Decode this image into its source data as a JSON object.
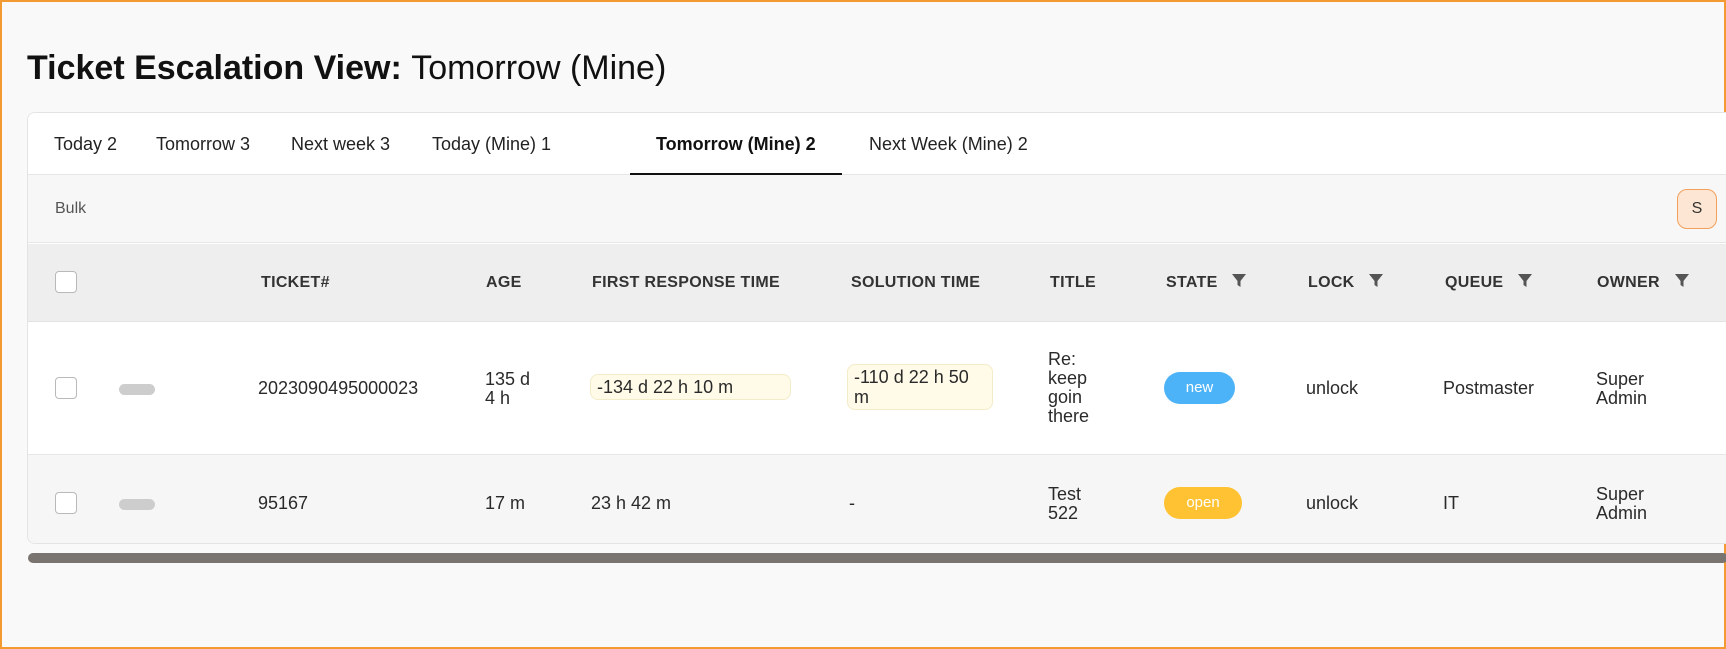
{
  "page": {
    "title_bold": "Ticket Escalation View:",
    "title_sub": "Tomorrow (Mine)"
  },
  "tabs": [
    {
      "label": "Today 2"
    },
    {
      "label": "Tomorrow 3"
    },
    {
      "label": "Next week 3"
    },
    {
      "label": "Today (Mine) 1"
    },
    {
      "label": "Tomorrow (Mine) 2"
    },
    {
      "label": "Next Week (Mine) 2"
    }
  ],
  "toolbar": {
    "bulk_label": "Bulk",
    "settings_label": "S"
  },
  "table": {
    "headers": {
      "ticket": "TICKET#",
      "age": "AGE",
      "first_response": "FIRST RESPONSE TIME",
      "solution": "SOLUTION TIME",
      "title": "TITLE",
      "state": "STATE",
      "lock": "LOCK",
      "queue": "QUEUE",
      "owner": "OWNER"
    },
    "rows": [
      {
        "ticket": "2023090495000023",
        "age_line1": "135 d",
        "age_line2": "4 h",
        "first_response": "-134 d 22 h 10 m",
        "solution_line1": "-110 d 22 h 50",
        "solution_line2": "m",
        "title_lines": [
          "Re:",
          "keep",
          "goin",
          "there"
        ],
        "state": "new",
        "lock": "unlock",
        "queue": "Postmaster",
        "owner_line1": "Super",
        "owner_line2": "Admin"
      },
      {
        "ticket": "95167",
        "age": "17 m",
        "first_response": "23 h 42 m",
        "solution": "-",
        "title_lines": [
          "Test",
          "522"
        ],
        "state": "open",
        "lock": "unlock",
        "queue": "IT",
        "owner_line1": "Super",
        "owner_line2": "Admin"
      }
    ]
  },
  "colors": {
    "accent_border": "#f49a32",
    "state_new": "#4db3f8",
    "state_open": "#ffc233"
  },
  "icons": {
    "filter": "filter-icon",
    "drag": "drag-handle-icon"
  }
}
